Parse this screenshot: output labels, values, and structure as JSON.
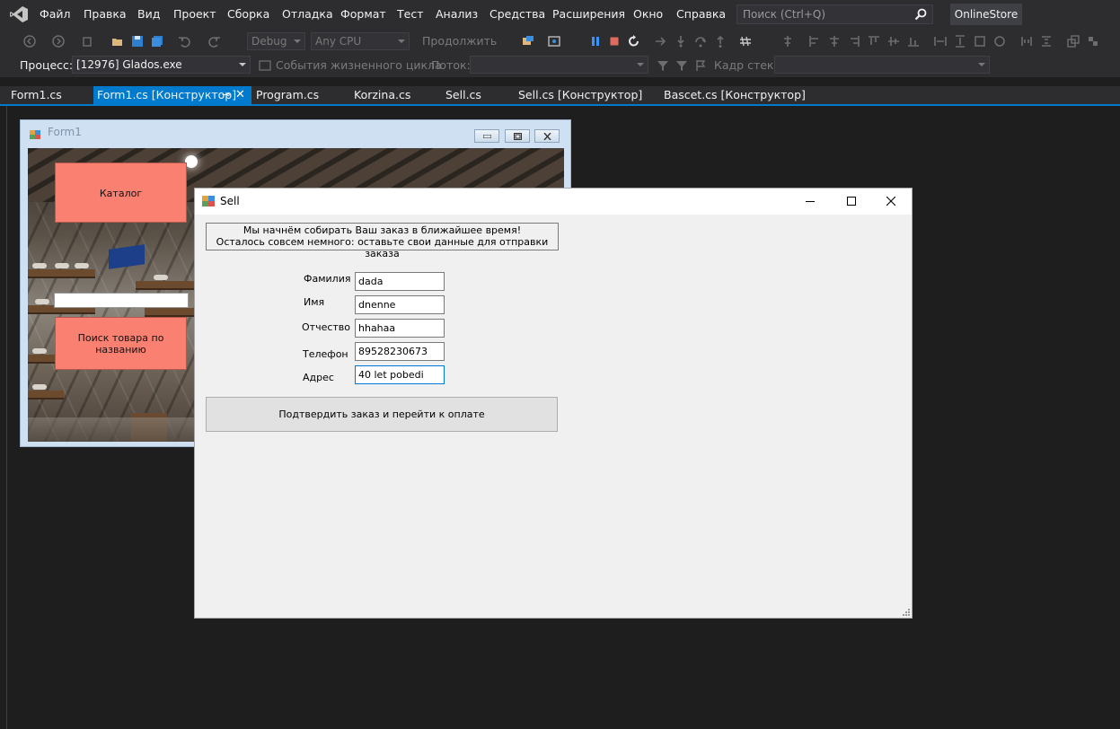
{
  "menu": {
    "items": [
      "Файл",
      "Правка",
      "Вид",
      "Проект",
      "Сборка",
      "Отладка",
      "Формат",
      "Тест",
      "Анализ",
      "Средства",
      "Расширения",
      "Окно",
      "Справка"
    ],
    "search_placeholder": "Поиск (Ctrl+Q)",
    "project_name": "OnlineStore"
  },
  "toolbar": {
    "configuration": "Debug",
    "platform": "Any CPU",
    "continue_label": "Продолжить"
  },
  "debug_bar": {
    "process_label": "Процесс:",
    "process_value": "[12976] Glados.exe",
    "lifecycle_events": "События жизненного цикла",
    "thread_label": "Поток:",
    "stack_frame_label": "Кадр стека:"
  },
  "tabs": [
    "Form1.cs",
    "Form1.cs [Конструктор]",
    "Program.cs",
    "Korzina.cs",
    "Sell.cs",
    "Sell.cs [Конструктор]",
    "Bascet.cs [Конструктор]"
  ],
  "form1": {
    "title": "Form1",
    "catalog_button": "Каталог",
    "search_button": "Поиск товара по названию"
  },
  "sell": {
    "title": "Sell",
    "info_line1": "Мы начнём собирать Ваш заказ в ближайшее время!",
    "info_line2": "Осталось совсем немного: оставьте свои данные для отправки заказа",
    "fields": [
      {
        "label": "Фамилия",
        "value": "dada"
      },
      {
        "label": "Имя",
        "value": "dnenne"
      },
      {
        "label": "Отчество",
        "value": "hhahaa"
      },
      {
        "label": "Телефон",
        "value": "89528230673"
      },
      {
        "label": "Адрес",
        "value": "40 let pobedi"
      }
    ],
    "confirm_button": "Подтвердить заказ и перейти к оплате"
  },
  "colors": {
    "ide_background": "#1e1e1e",
    "ide_chrome": "#2d2d30",
    "accent": "#007acc",
    "salmon_button": "#fa8072",
    "winform_background": "#f0f0f0"
  }
}
